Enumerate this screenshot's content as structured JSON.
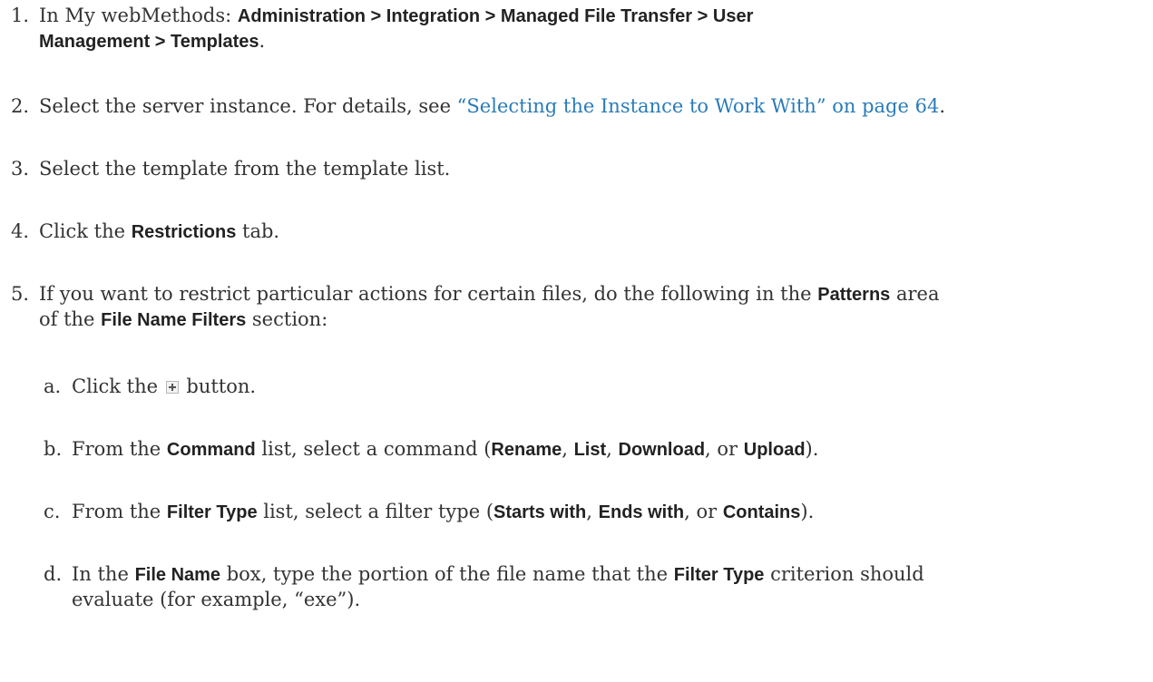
{
  "steps": [
    {
      "num": "1.",
      "t0": "In My webMethods: ",
      "b0": "Administration > Integration > Managed File Transfer > User",
      "b1": "Management > Templates",
      "t1": "."
    },
    {
      "num": "2.",
      "t0": "Select the server instance. For details, see ",
      "link": "“Selecting the Instance to Work With” on page 64",
      "t1": "."
    },
    {
      "num": "3.",
      "t0": "Select the template from the template list."
    },
    {
      "num": "4.",
      "t0": "Click the ",
      "b0": "Restrictions",
      "t1": " tab."
    },
    {
      "num": "5.",
      "t0": "If you want to restrict particular actions for certain files, do the following in the ",
      "b0": "Patterns",
      "t1": " area",
      "t2": "of the ",
      "b1": "File Name Filters",
      "t3": " section:"
    }
  ],
  "substeps": [
    {
      "num": "a.",
      "t0": "Click the ",
      "icon": "plus-icon",
      "t1": " button."
    },
    {
      "num": "b.",
      "t0": "From the ",
      "b0": "Command",
      "t1": " list, select a command (",
      "b1": "Rename",
      "t2": ", ",
      "b2": "List",
      "t3": ", ",
      "b3": "Download",
      "t4": ", or ",
      "b4": "Upload",
      "t5": ")."
    },
    {
      "num": "c.",
      "t0": "From the ",
      "b0": "Filter Type",
      "t1": " list, select a filter type (",
      "b1": "Starts with",
      "t2": ", ",
      "b2": "Ends with",
      "t3": ", or ",
      "b3": "Contains",
      "t4": ")."
    },
    {
      "num": "d.",
      "t0": "In the ",
      "b0": "File Name",
      "t1": " box, type the portion of the file name that the ",
      "b1": "Filter Type",
      "t2": " criterion should",
      "t3": "evaluate (for example, “exe”)."
    }
  ]
}
